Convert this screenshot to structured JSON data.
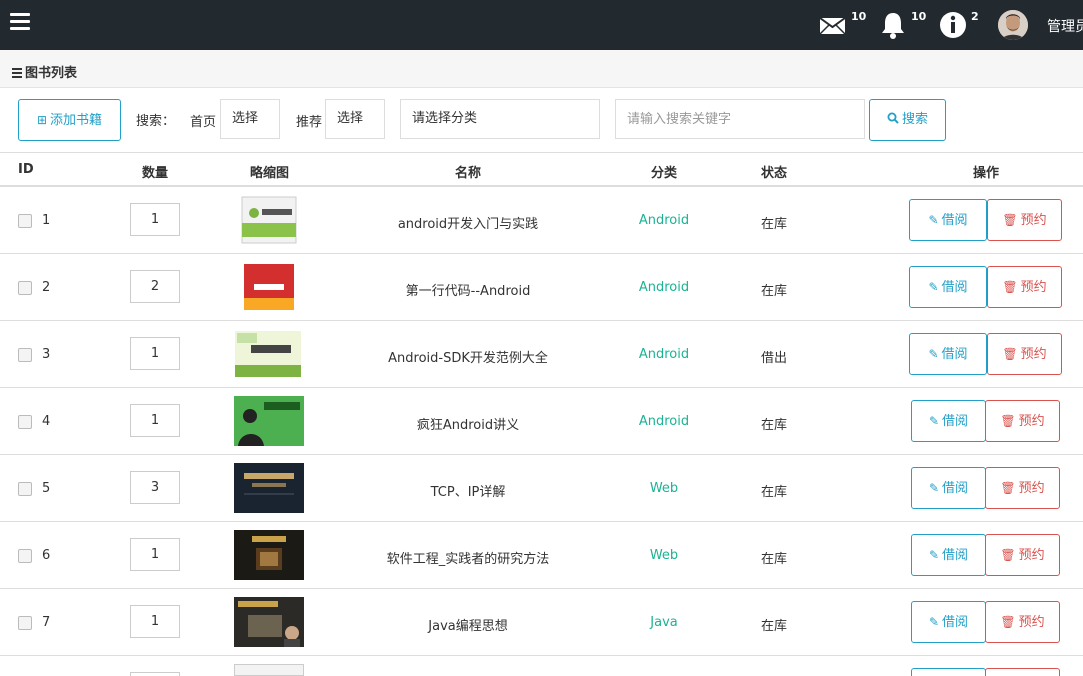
{
  "navbar": {
    "mail_count": "10",
    "bell_count": "10",
    "info_count": "2",
    "user_name": "管理员"
  },
  "panel": {
    "title": "图书列表"
  },
  "toolbar": {
    "add_label": "添加书籍",
    "search_label": "搜索：",
    "home_label": "首页",
    "home_select": "选择",
    "recommend_label": "推荐",
    "recommend_select": "选择",
    "category_select": "请选择分类",
    "keyword_placeholder": "请输入搜索关键字",
    "search_button": "搜索"
  },
  "table": {
    "headers": {
      "id": "ID",
      "qty": "数量",
      "thumb": "略缩图",
      "name": "名称",
      "category": "分类",
      "status": "状态",
      "actions": "操作"
    },
    "borrow_label": "借阅",
    "reserve_label": "预约",
    "rows": [
      {
        "id": "1",
        "qty": "1",
        "name": "android开发入门与实践",
        "category": "Android",
        "status": "在库"
      },
      {
        "id": "2",
        "qty": "2",
        "name": "第一行代码--Android",
        "category": "Android",
        "status": "在库"
      },
      {
        "id": "3",
        "qty": "1",
        "name": "Android-SDK开发范例大全",
        "category": "Android",
        "status": "借出"
      },
      {
        "id": "4",
        "qty": "1",
        "name": "疯狂Android讲义",
        "category": "Android",
        "status": "在库"
      },
      {
        "id": "5",
        "qty": "3",
        "name": "TCP、IP详解",
        "category": "Web",
        "status": "在库"
      },
      {
        "id": "6",
        "qty": "1",
        "name": "软件工程_实践者的研究方法",
        "category": "Web",
        "status": "在库"
      },
      {
        "id": "7",
        "qty": "1",
        "name": "Java编程思想",
        "category": "Java",
        "status": "在库"
      }
    ]
  },
  "colors": {
    "navbar": "#222a30",
    "accent": "#23a0c9",
    "danger": "#d9534f",
    "category": "#1ab394"
  }
}
